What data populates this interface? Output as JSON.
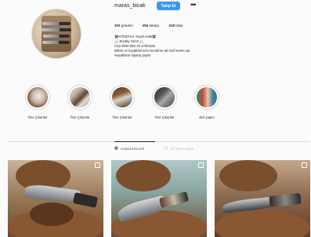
{
  "profile": {
    "username": "maras_bicak",
    "follow_label": "Takip Et",
    "more_icon": "more-horizontal-icon",
    "stats": {
      "posts": "202",
      "posts_label": "gönderi",
      "followers": "494",
      "followers_label": "takipçi",
      "following": "218",
      "following_label": "takip"
    },
    "bio": [
      "✖️KÖNDİ Kıl. bıçak evde✖️",
      "⚔️ Bıçaky Yazın ⚔️",
      "Cep 0530 552 40 47İletişim",
      "Bütün ve bıçaklarımızın kendime ait özel kesim var",
      "Hoşaflıktırl sipariş yapılır"
    ]
  },
  "highlights": [
    {
      "label": "Öne Çıkanlar"
    },
    {
      "label": "Öne Çıkanlar"
    },
    {
      "label": "Öne Çıkanlar"
    },
    {
      "label": "Öne Çıkanlar"
    },
    {
      "label": "deri yapım"
    }
  ],
  "tabs": {
    "posts_label": "GÖNDERİLER",
    "tagged_label": "ETİKETLENDİ"
  },
  "colors": {
    "follow_button": "#3897f0",
    "active_tab": "#262626"
  }
}
